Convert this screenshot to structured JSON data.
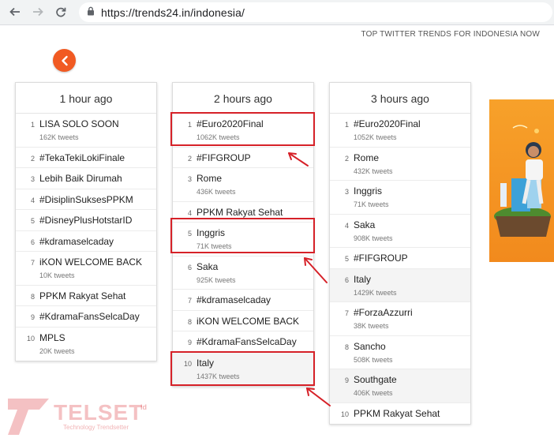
{
  "browser": {
    "url": "https://trends24.in/indonesia/"
  },
  "page": {
    "header": "TOP TWITTER TRENDS FOR INDONESIA NOW"
  },
  "columns": [
    {
      "title": "1 hour ago",
      "items": [
        {
          "rank": "1",
          "name": "LISA SOLO SOON",
          "count": "162K tweets"
        },
        {
          "rank": "2",
          "name": "#TekaTekiLokiFinale",
          "count": ""
        },
        {
          "rank": "3",
          "name": "Lebih Baik Dirumah",
          "count": ""
        },
        {
          "rank": "4",
          "name": "#DisiplinSuksesPPKM",
          "count": ""
        },
        {
          "rank": "5",
          "name": "#DisneyPlusHotstarID",
          "count": ""
        },
        {
          "rank": "6",
          "name": "#kdramaselcaday",
          "count": ""
        },
        {
          "rank": "7",
          "name": "iKON WELCOME BACK",
          "count": "10K tweets"
        },
        {
          "rank": "8",
          "name": "PPKM Rakyat Sehat",
          "count": ""
        },
        {
          "rank": "9",
          "name": "#KdramaFansSelcaDay",
          "count": ""
        },
        {
          "rank": "10",
          "name": "MPLS",
          "count": "20K tweets"
        }
      ]
    },
    {
      "title": "2 hours ago",
      "items": [
        {
          "rank": "1",
          "name": "#Euro2020Final",
          "count": "1062K tweets"
        },
        {
          "rank": "2",
          "name": "#FIFGROUP",
          "count": ""
        },
        {
          "rank": "3",
          "name": "Rome",
          "count": "436K tweets"
        },
        {
          "rank": "4",
          "name": "PPKM Rakyat Sehat",
          "count": ""
        },
        {
          "rank": "5",
          "name": "Inggris",
          "count": "71K tweets"
        },
        {
          "rank": "6",
          "name": "Saka",
          "count": "925K tweets"
        },
        {
          "rank": "7",
          "name": "#kdramaselcaday",
          "count": ""
        },
        {
          "rank": "8",
          "name": "iKON WELCOME BACK",
          "count": ""
        },
        {
          "rank": "9",
          "name": "#KdramaFansSelcaDay",
          "count": ""
        },
        {
          "rank": "10",
          "name": "Italy",
          "count": "1437K tweets"
        }
      ]
    },
    {
      "title": "3 hours ago",
      "items": [
        {
          "rank": "1",
          "name": "#Euro2020Final",
          "count": "1052K tweets"
        },
        {
          "rank": "2",
          "name": "Rome",
          "count": "432K tweets"
        },
        {
          "rank": "3",
          "name": "Inggris",
          "count": "71K tweets"
        },
        {
          "rank": "4",
          "name": "Saka",
          "count": "908K tweets"
        },
        {
          "rank": "5",
          "name": "#FIFGROUP",
          "count": ""
        },
        {
          "rank": "6",
          "name": "Italy",
          "count": "1429K tweets"
        },
        {
          "rank": "7",
          "name": "#ForzaAzzurri",
          "count": "38K tweets"
        },
        {
          "rank": "8",
          "name": "Sancho",
          "count": "508K tweets"
        },
        {
          "rank": "9",
          "name": "Southgate",
          "count": "406K tweets"
        },
        {
          "rank": "10",
          "name": "PPKM Rakyat Sehat",
          "count": ""
        }
      ]
    }
  ],
  "watermark": {
    "brand": "TELSET",
    "suffix": "id",
    "tagline": "Technology Trendsetter"
  },
  "colors": {
    "accent": "#f15a22",
    "annotation": "#d62128"
  }
}
